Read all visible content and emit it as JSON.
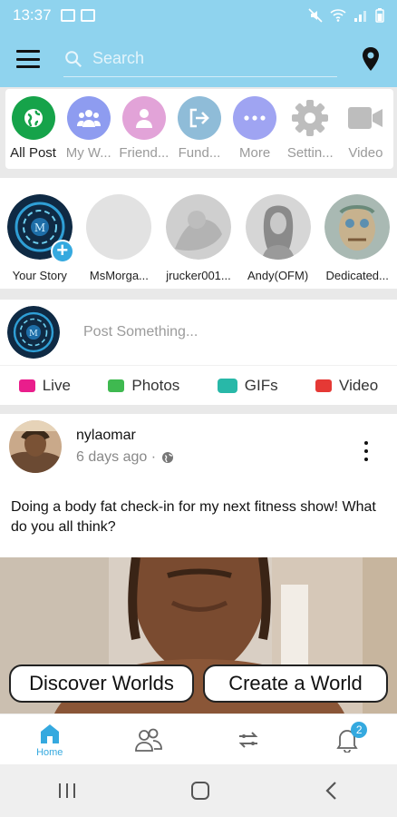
{
  "status_bar": {
    "time": "13:37"
  },
  "topbar": {
    "search_placeholder": "Search"
  },
  "quick_menu": [
    {
      "label": "All Post",
      "icon": "globe-icon",
      "color": "#16a34a"
    },
    {
      "label": "My W...",
      "icon": "group-icon",
      "color": "#8e9cf0"
    },
    {
      "label": "Friend...",
      "icon": "person-icon",
      "color": "#e2a3d8"
    },
    {
      "label": "Fund...",
      "icon": "export-icon",
      "color": "#8fbcd8"
    },
    {
      "label": "More",
      "icon": "more-icon",
      "color": "#9fa4f2"
    },
    {
      "label": "Settin...",
      "icon": "gear-icon",
      "color": "#c9c9c9"
    },
    {
      "label": "Video",
      "icon": "video-icon",
      "color": "#c9c9c9"
    }
  ],
  "stories": [
    {
      "label": "Your Story"
    },
    {
      "label": "MsMorga..."
    },
    {
      "label": "jrucker001..."
    },
    {
      "label": "Andy(OFM)"
    },
    {
      "label": "Dedicated..."
    }
  ],
  "composer": {
    "placeholder": "Post Something...",
    "actions": [
      {
        "label": "Live",
        "color": "#e91e8c"
      },
      {
        "label": "Photos",
        "color": "#3fb950"
      },
      {
        "label": "GIFs",
        "color": "#28b8a8"
      },
      {
        "label": "Video",
        "color": "#e53935"
      }
    ]
  },
  "post": {
    "author": "nylaomar",
    "time": "6 days ago ·",
    "text": "Doing a body fat check-in for my next fitness show! What do you all think?"
  },
  "buttons": {
    "discover": "Discover Worlds",
    "create": "Create a World"
  },
  "bottom_nav": {
    "home_label": "Home",
    "notifications_badge": "2"
  },
  "colors": {
    "accent": "#35a9df",
    "topbar": "#8fd3ee"
  }
}
